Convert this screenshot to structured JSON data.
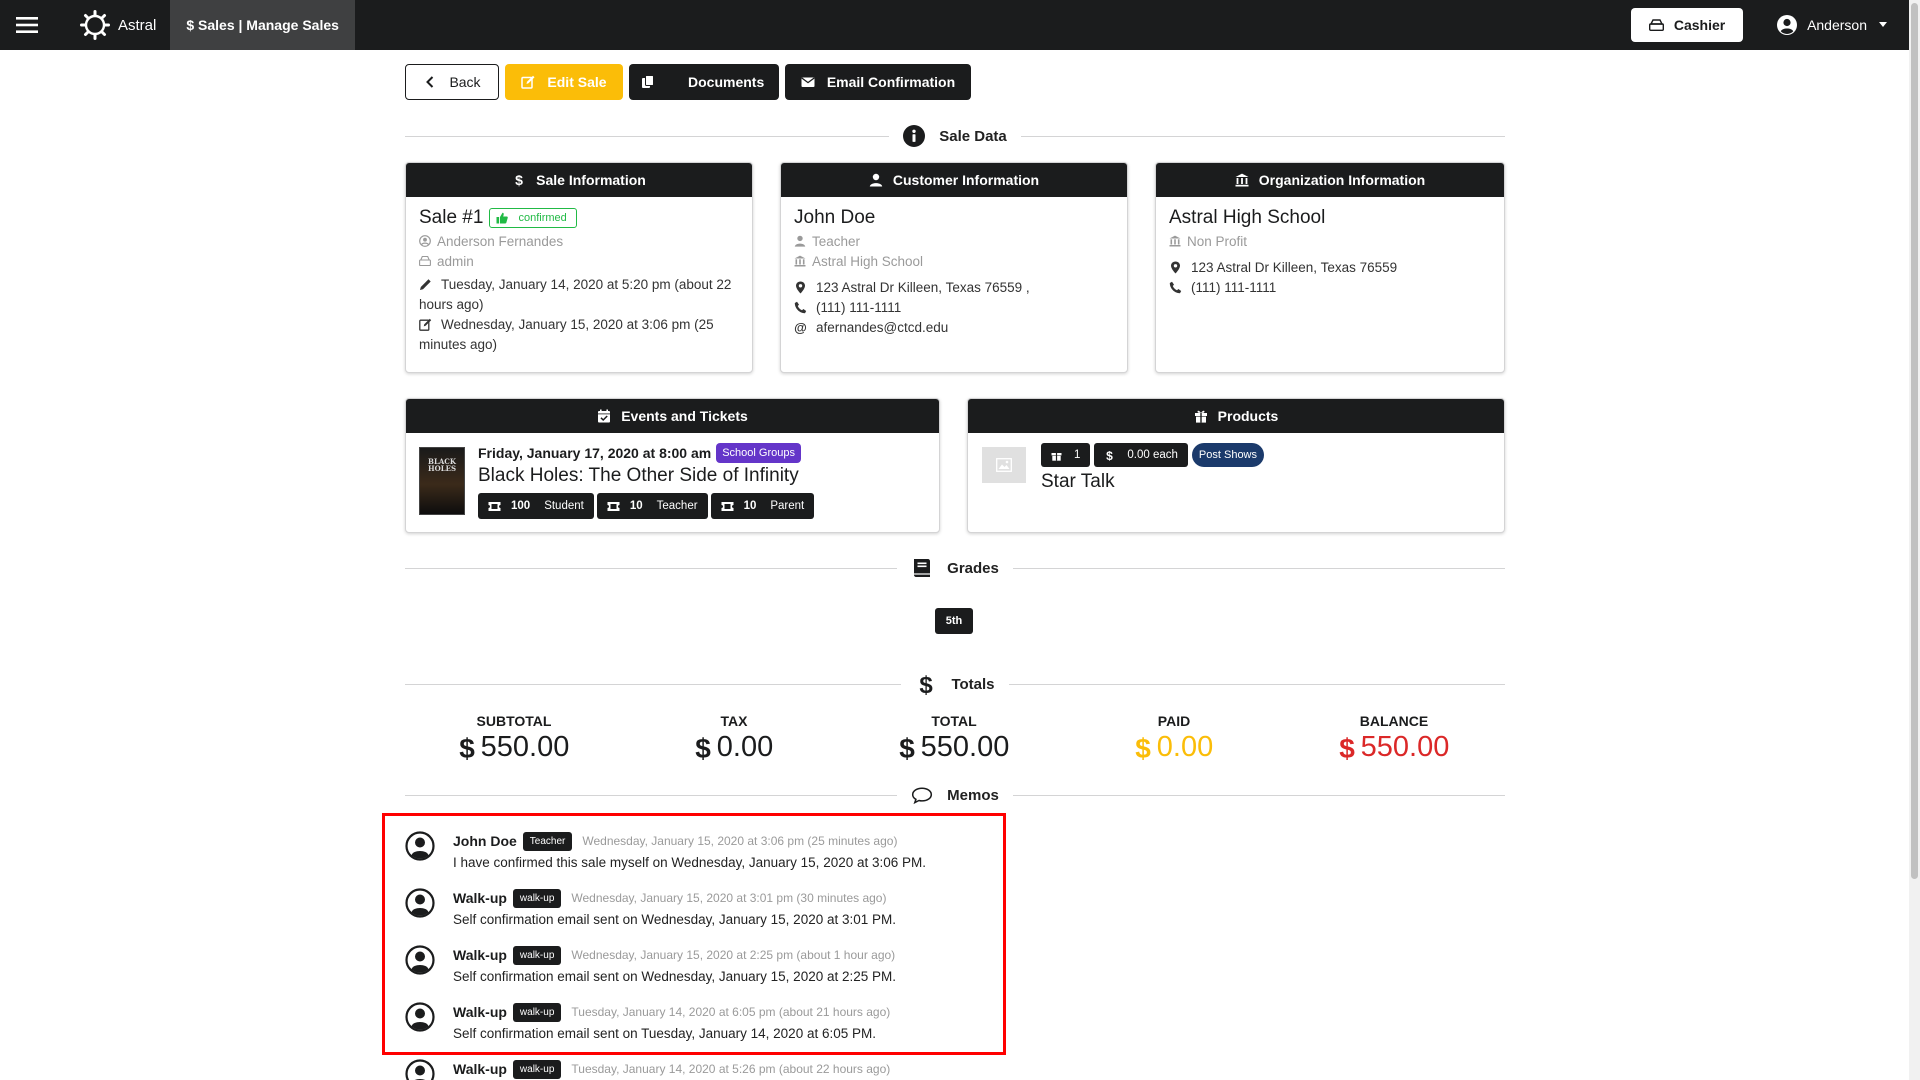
{
  "navbar": {
    "brand": "Astral",
    "active_tab": "$ Sales | Manage Sales",
    "cashier_label": "Cashier",
    "user_name": "Anderson"
  },
  "actions": {
    "back": "Back",
    "edit": "Edit Sale",
    "documents": "Documents",
    "email": "Email Confirmation"
  },
  "sections": {
    "sale_data": "Sale Data",
    "grades": "Grades",
    "totals": "Totals",
    "memos": "Memos"
  },
  "sale_info": {
    "header": "Sale Information",
    "title": "Sale #1",
    "status": "confirmed",
    "salesperson": "Anderson Fernandes",
    "role": "admin",
    "created": "Tuesday, January 14, 2020 at 5:20 pm (about 22 hours ago)",
    "updated": "Wednesday, January 15, 2020 at 3:06 pm (25 minutes ago)"
  },
  "customer_info": {
    "header": "Customer Information",
    "name": "John Doe",
    "role": "Teacher",
    "organization": "Astral High School",
    "address": "123 Astral Dr Killeen, Texas 76559 ,",
    "phone": "(111) 111-1111",
    "email": "afernandes@ctcd.edu"
  },
  "org_info": {
    "header": "Organization Information",
    "name": "Astral High School",
    "type": "Non Profit",
    "address": "123 Astral Dr Killeen, Texas 76559",
    "phone": "(111) 111-1111"
  },
  "events": {
    "header": "Events and Tickets",
    "date": "Friday, January 17, 2020 at 8:00 am",
    "tag": "School Groups",
    "title": "Black Holes: The Other Side of Infinity",
    "poster_text": "BLACK HOLES",
    "tickets": [
      {
        "count": "100",
        "type": "Student"
      },
      {
        "count": "10",
        "type": "Teacher"
      },
      {
        "count": "10",
        "type": "Parent"
      }
    ]
  },
  "products": {
    "header": "Products",
    "quantity": "1",
    "price": "0.00 each",
    "tag": "Post Shows",
    "name": "Star Talk"
  },
  "grades": [
    "5th"
  ],
  "totals": {
    "subtotal_label": "SUBTOTAL",
    "subtotal": "550.00",
    "tax_label": "TAX",
    "tax": "0.00",
    "total_label": "TOTAL",
    "total": "550.00",
    "paid_label": "PAID",
    "paid": "0.00",
    "balance_label": "BALANCE",
    "balance": "550.00"
  },
  "memos": [
    {
      "author": "John Doe",
      "tag": "Teacher",
      "time": "Wednesday, January 15, 2020 at 3:06 pm (25 minutes ago)",
      "text": "I have confirmed this sale myself on Wednesday, January 15, 2020 at 3:06 PM."
    },
    {
      "author": "Walk-up",
      "tag": "walk-up",
      "time": "Wednesday, January 15, 2020 at 3:01 pm (30 minutes ago)",
      "text": "Self confirmation email sent on Wednesday, January 15, 2020 at 3:01 PM."
    },
    {
      "author": "Walk-up",
      "tag": "walk-up",
      "time": "Wednesday, January 15, 2020 at 2:25 pm (about 1 hour ago)",
      "text": "Self confirmation email sent on Wednesday, January 15, 2020 at 2:25 PM."
    },
    {
      "author": "Walk-up",
      "tag": "walk-up",
      "time": "Tuesday, January 14, 2020 at 6:05 pm (about 21 hours ago)",
      "text": "Self confirmation email sent on Tuesday, January 14, 2020 at 6:05 PM."
    },
    {
      "author": "Walk-up",
      "tag": "walk-up",
      "time": "Tuesday, January 14, 2020 at 5:26 pm (about 22 hours ago)",
      "text": ""
    }
  ],
  "colors": {
    "dark": "#1b1c1d",
    "yellow": "#fbbd08",
    "red": "#db2828",
    "green": "#21ba45",
    "purple": "#6435c9",
    "navy": "#1b3a6b",
    "highlight": "#ff0000"
  },
  "icons": {
    "menu": "hamburger-icon",
    "brand": "gear-logo-icon",
    "cashier": "cash-register-icon",
    "user": "user-circle-icon",
    "info": "info-circle-icon",
    "dollar": "dollar-icon",
    "grades": "book-icon",
    "memos": "comment-icon"
  }
}
